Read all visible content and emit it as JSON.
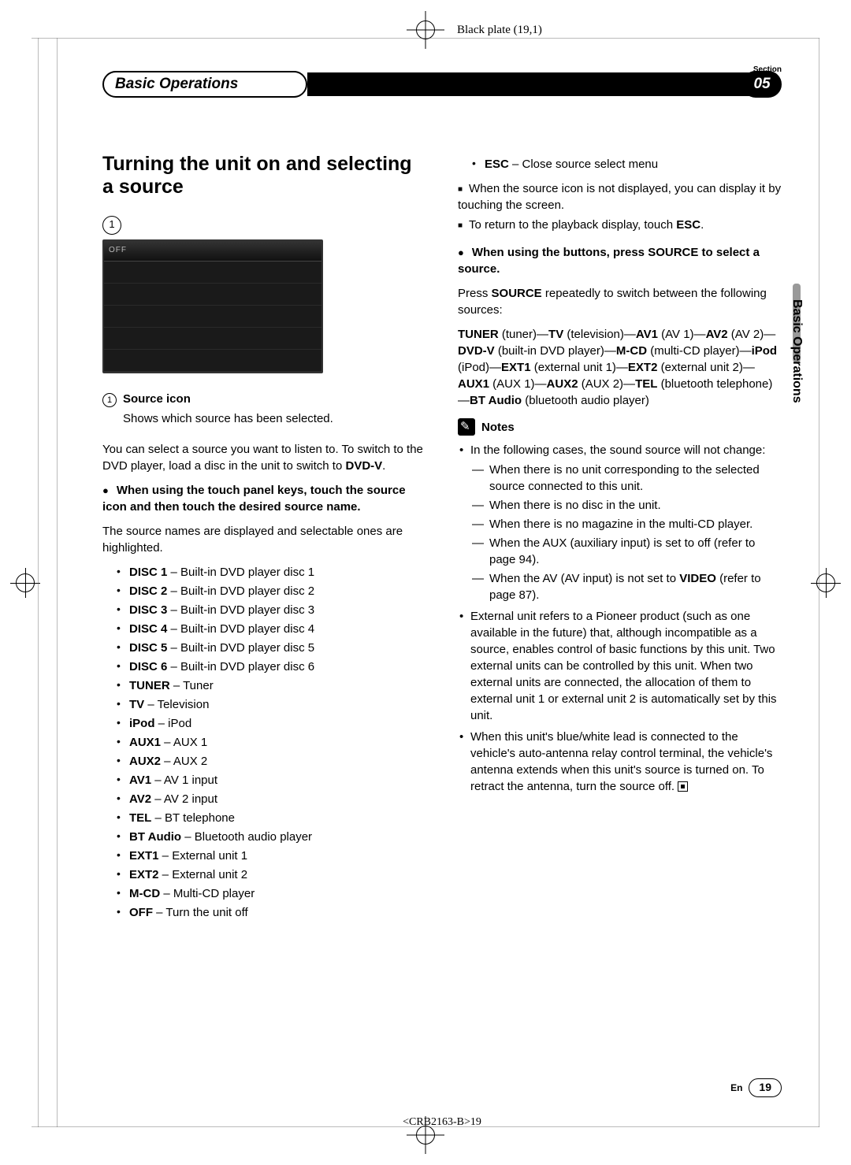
{
  "meta": {
    "black_plate": "Black plate (19,1)",
    "doc_code": "<CRB2163-B>19"
  },
  "header": {
    "section_label": "Section",
    "title": "Basic Operations",
    "section_number": "05",
    "side_tab": "Basic Operations"
  },
  "left": {
    "title": "Turning the unit on and selecting a source",
    "callout_num": "1",
    "screen_off_label": "OFF",
    "source_icon_label": "Source icon",
    "source_icon_desc": "Shows which source has been selected.",
    "intro": "You can select a source you want to listen to. To switch to the DVD player, load a disc in the unit to switch to ",
    "intro_bold": "DVD-V",
    "touch_heading": "When using the touch panel keys, touch the source icon and then touch the desired source name.",
    "touch_desc": "The source names are displayed and selectable ones are highlighted.",
    "sources": [
      {
        "b": "DISC 1",
        "t": " – Built-in DVD player disc 1"
      },
      {
        "b": "DISC 2",
        "t": " – Built-in DVD player disc 2"
      },
      {
        "b": "DISC 3",
        "t": " – Built-in DVD player disc 3"
      },
      {
        "b": "DISC 4",
        "t": " – Built-in DVD player disc 4"
      },
      {
        "b": "DISC 5",
        "t": " – Built-in DVD player disc 5"
      },
      {
        "b": "DISC 6",
        "t": " – Built-in DVD player disc 6"
      },
      {
        "b": "TUNER",
        "t": " – Tuner"
      },
      {
        "b": "TV",
        "t": " – Television"
      },
      {
        "b": "iPod",
        "t": " – iPod"
      },
      {
        "b": "AUX1",
        "t": " – AUX 1"
      },
      {
        "b": "AUX2",
        "t": " – AUX 2"
      },
      {
        "b": "AV1",
        "t": " – AV 1 input"
      },
      {
        "b": "AV2",
        "t": " – AV 2 input"
      },
      {
        "b": "TEL",
        "t": " – BT telephone"
      },
      {
        "b": "BT Audio",
        "t": " – Bluetooth audio player"
      },
      {
        "b": "EXT1",
        "t": " – External unit 1"
      },
      {
        "b": "EXT2",
        "t": " – External unit 2"
      },
      {
        "b": "M-CD",
        "t": " – Multi-CD player"
      },
      {
        "b": "OFF",
        "t": " – Turn the unit off"
      }
    ]
  },
  "right": {
    "esc_b": "ESC",
    "esc_t": " – Close source select menu",
    "hint1": "When the source icon is not displayed, you can display it by touching the screen.",
    "hint2_a": "To return to the playback display, touch ",
    "hint2_b": "ESC",
    "buttons_heading": "When using the buttons, press SOURCE to select a source.",
    "press_a": "Press ",
    "press_b": "SOURCE",
    "press_c": " repeatedly to switch between the following sources:",
    "chain": [
      {
        "b": "TUNER",
        "t": " (tuner)—"
      },
      {
        "b": "TV",
        "t": " (television)—"
      },
      {
        "b": "AV1",
        "t": " (AV 1)—"
      },
      {
        "b": "AV2",
        "t": " (AV 2)—"
      },
      {
        "b": "DVD-V",
        "t": " (built-in DVD player)—"
      },
      {
        "b": "M-CD",
        "t": " (multi-CD player)—"
      },
      {
        "b": "iPod",
        "t": " (iPod)—"
      },
      {
        "b": "EXT1",
        "t": " (external unit 1)—"
      },
      {
        "b": "EXT2",
        "t": " (external unit 2)—"
      },
      {
        "b": "AUX1",
        "t": " (AUX 1)—"
      },
      {
        "b": "AUX2",
        "t": " (AUX 2)—"
      },
      {
        "b": "TEL",
        "t": " (bluetooth telephone)—"
      },
      {
        "b": "BT Audio",
        "t": " (bluetooth audio player)"
      }
    ],
    "notes_label": "Notes",
    "note1_lead": "In the following cases, the sound source will not change:",
    "note1_items": [
      "When there is no unit corresponding to the selected source connected to this unit.",
      "When there is no disc in the unit.",
      "When there is no magazine in the multi-CD player.",
      "When the AUX (auxiliary input) is set to off (refer to page 94).",
      "When the AV (AV input) is not set to VIDEO (refer to page 87)."
    ],
    "note1_video_bold": "VIDEO",
    "note2": "External unit refers to a Pioneer product (such as one available in the future) that, although incompatible as a source, enables control of basic functions by this unit. Two external units can be controlled by this unit. When two external units are connected, the allocation of them to external unit 1 or external unit 2 is automatically set by this unit.",
    "note3": "When this unit's blue/white lead is connected to the vehicle's auto-antenna relay control terminal, the vehicle's antenna extends when this unit's source is turned on. To retract the antenna, turn the source off."
  },
  "footer": {
    "lang": "En",
    "page": "19"
  }
}
